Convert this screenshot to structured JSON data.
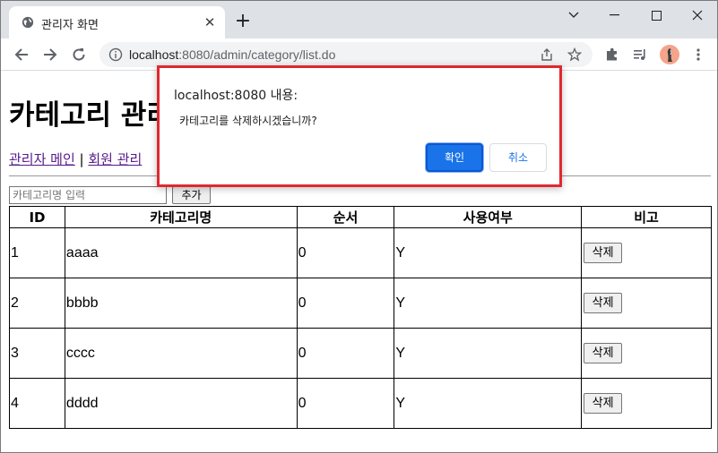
{
  "browser": {
    "tab_title": "관리자 화면",
    "new_tab": "+",
    "url_host": "localhost",
    "url_rest": ":8080/admin/category/list.do"
  },
  "page": {
    "title": "카테고리 관리",
    "nav_main": "관리자 메인",
    "nav_sep": " | ",
    "nav_member": "회원 관리",
    "input_placeholder": "카테고리명 입력",
    "add_button": "추가",
    "columns": [
      "ID",
      "카테고리명",
      "순서",
      "사용여부",
      "비고"
    ],
    "rows": [
      {
        "id": "1",
        "name": "aaaa",
        "order": "0",
        "use": "Y",
        "action": "삭제"
      },
      {
        "id": "2",
        "name": "bbbb",
        "order": "0",
        "use": "Y",
        "action": "삭제"
      },
      {
        "id": "3",
        "name": "cccc",
        "order": "0",
        "use": "Y",
        "action": "삭제"
      },
      {
        "id": "4",
        "name": "dddd",
        "order": "0",
        "use": "Y",
        "action": "삭제"
      }
    ]
  },
  "dialog": {
    "origin": "localhost:8080 내용:",
    "message": "카테고리를 삭제하시겠습니까?",
    "ok": "확인",
    "cancel": "취소"
  },
  "colors": {
    "accent": "#1a73e8",
    "highlight_border": "#e0282f",
    "visited_link": "#551a8b"
  }
}
